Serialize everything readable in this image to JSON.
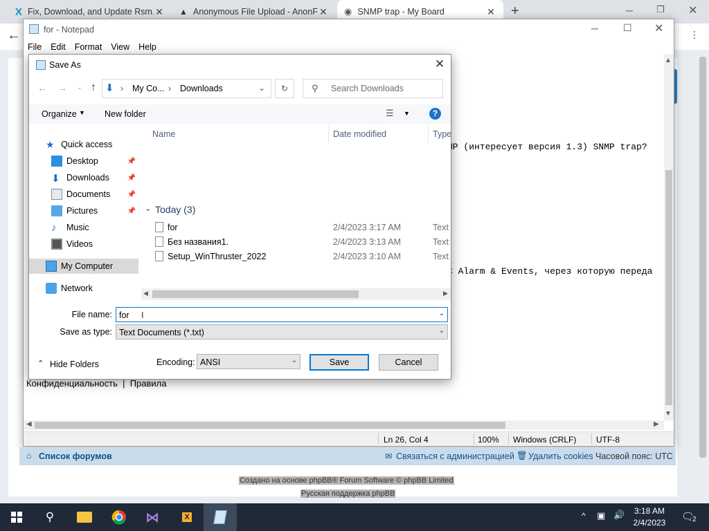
{
  "browser": {
    "tabs": [
      {
        "label": "Fix, Download, and Update Rsm..."
      },
      {
        "label": "Anonymous File Upload - AnonFi..."
      },
      {
        "label": "SNMP trap - My Board"
      }
    ],
    "new_tab": "+"
  },
  "notepad": {
    "title": "for - Notepad",
    "menu": [
      "File",
      "Edit",
      "Format",
      "View",
      "Help"
    ],
    "text_lines": [
      {
        "text": "MP (интересует версия 1.3) SNMP trap?"
      },
      {
        "text": "C Alarm & Events, через которую переда"
      },
      {
        "text": "Конфиденциальность  |  Правила"
      }
    ],
    "status": {
      "position": "Ln 26, Col 4",
      "zoom": "100%",
      "line_ending": "Windows (CRLF)",
      "encoding": "UTF-8"
    }
  },
  "saveas": {
    "title": "Save As",
    "address": [
      "My Co...",
      "Downloads"
    ],
    "search_placeholder": "Search Downloads",
    "organize": "Organize",
    "new_folder": "New folder",
    "help": "?",
    "nav": [
      {
        "label": "Quick access",
        "pinned": false
      },
      {
        "label": "Desktop",
        "pinned": true
      },
      {
        "label": "Downloads",
        "pinned": true
      },
      {
        "label": "Documents",
        "pinned": true
      },
      {
        "label": "Pictures",
        "pinned": true
      },
      {
        "label": "Music",
        "pinned": false
      },
      {
        "label": "Videos",
        "pinned": false
      },
      {
        "label": "My Computer",
        "pinned": false
      },
      {
        "label": "Network",
        "pinned": false
      }
    ],
    "columns": {
      "name": "Name",
      "date": "Date modified",
      "type": "Type"
    },
    "group": "Today (3)",
    "files": [
      {
        "name": "for",
        "date": "2/4/2023 3:17 AM",
        "type": "Text D"
      },
      {
        "name": "Без названия1.",
        "date": "2/4/2023 3:13 AM",
        "type": "Text D"
      },
      {
        "name": "Setup_WinThruster_2022",
        "date": "2/4/2023 3:10 AM",
        "type": "Text D"
      }
    ],
    "file_name_label": "File name:",
    "file_name_value": "for",
    "save_type_label": "Save as type:",
    "save_type_value": "Text Documents (*.txt)",
    "hide_folders": "Hide Folders",
    "encoding_label": "Encoding:",
    "encoding_value": "ANSI",
    "save": "Save",
    "cancel": "Cancel"
  },
  "forum": {
    "index": "Список форумов",
    "contact": "Связаться с администрацией",
    "cookies": "Удалить cookies",
    "timezone": "Часовой пояс: UTC",
    "powered": "Создано на основе phpBB® Forum Software © phpBB Limited",
    "support": "Русская поддержка phpBB"
  },
  "taskbar": {
    "time": "3:18 AM",
    "date": "2/4/2023",
    "notifications": "2"
  }
}
